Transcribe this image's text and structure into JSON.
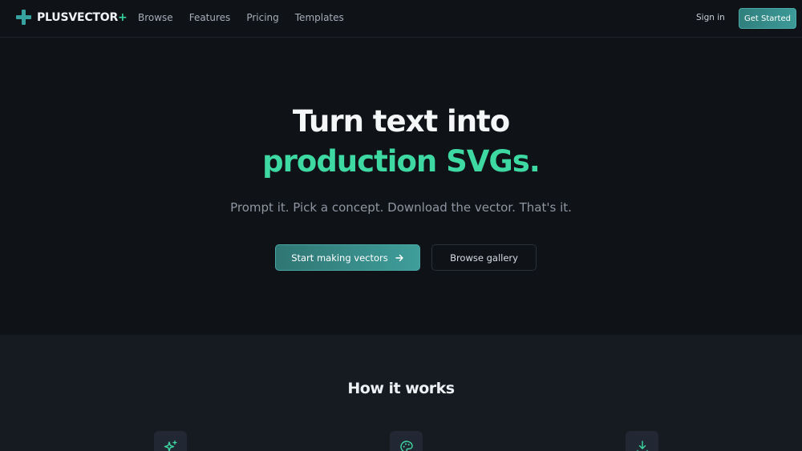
{
  "brand": {
    "name": "PLUSVECTOR",
    "suffix": "+",
    "accent": "#37a3a0",
    "green": "#3ed9a3"
  },
  "nav": {
    "links": [
      "Browse",
      "Features",
      "Pricing",
      "Templates"
    ],
    "sign_in": "Sign in",
    "get_started": "Get Started"
  },
  "hero": {
    "headline_line1": "Turn text into",
    "headline_line2": "production SVGs.",
    "subtitle": "Prompt it. Pick a concept. Download the vector. That's it.",
    "primary_cta": "Start making vectors",
    "secondary_cta": "Browse gallery"
  },
  "how": {
    "title": "How it works",
    "step_icons": [
      "sparkles-icon",
      "palette-icon",
      "download-icon"
    ]
  }
}
